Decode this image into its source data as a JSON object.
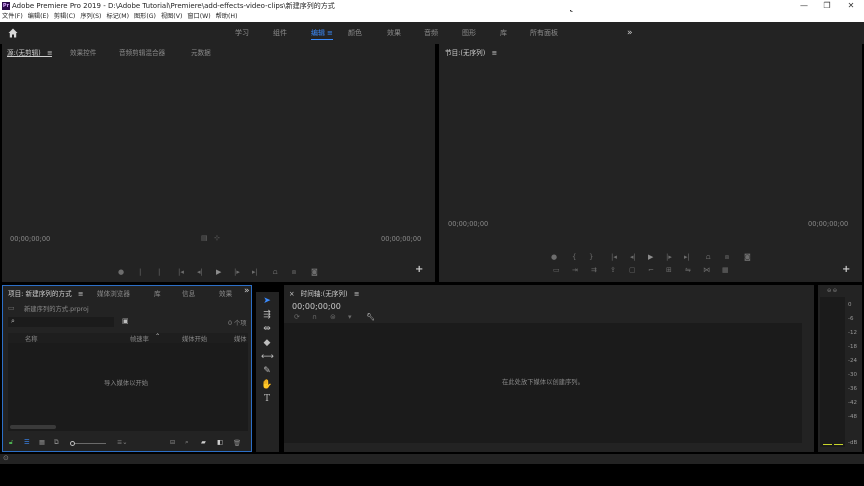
{
  "window": {
    "title": "Adobe Premiere Pro 2019 - D:\\Adobe Tutorial\\Premiere\\add-effects-video-clips\\新建序列的方式",
    "logo": "Pr",
    "minimize": "—",
    "maximize": "❐",
    "close": "✕"
  },
  "menu": [
    "文件(F)",
    "编辑(E)",
    "剪辑(C)",
    "序列(S)",
    "标记(M)",
    "图形(G)",
    "视图(V)",
    "窗口(W)",
    "帮助(H)"
  ],
  "workspaces": {
    "items": [
      "学习",
      "组件",
      "编辑",
      "颜色",
      "效果",
      "音频",
      "图形",
      "库",
      "所有面板"
    ],
    "active": "编辑",
    "overflow": "»",
    "accent": "#3b8cff"
  },
  "source_panel": {
    "tabs": [
      "源:(无剪辑)",
      "效果控件",
      "音频剪辑混合器",
      "元数据"
    ],
    "menu_glyph": "≡",
    "timecode_left": "00;00;00;00",
    "timecode_right": "00;00;00;00",
    "add": "+"
  },
  "program_panel": {
    "tab": "节目:(无序列)",
    "menu_glyph": "≡",
    "timecode_left": "00;00;00;00",
    "timecode_right": "00;00;00;00",
    "add": "+"
  },
  "project_panel": {
    "tabs": [
      "项目: 新建序列的方式",
      "媒体浏览器",
      "库",
      "信息",
      "效果"
    ],
    "menu_glyph": "≡",
    "overflow": "»",
    "project_file": "新建序列的方式.prproj",
    "item_count": "0 个项",
    "columns": [
      "名称",
      "帧速率",
      "媒体开始",
      "媒体"
    ],
    "empty_message": "导入媒体以开始"
  },
  "timeline_panel": {
    "close": "×",
    "title": "时间轴:(无序列)",
    "menu_glyph": "≡",
    "timecode": "00;00;00;00",
    "empty_message": "在此处放下媒体以创建序列。"
  },
  "audio_meter": {
    "labels": [
      "0",
      "-6",
      "-12",
      "-18",
      "-24",
      "-30",
      "-36",
      "-42",
      "-48",
      "-dB"
    ],
    "level_color": "#c8d62a"
  }
}
